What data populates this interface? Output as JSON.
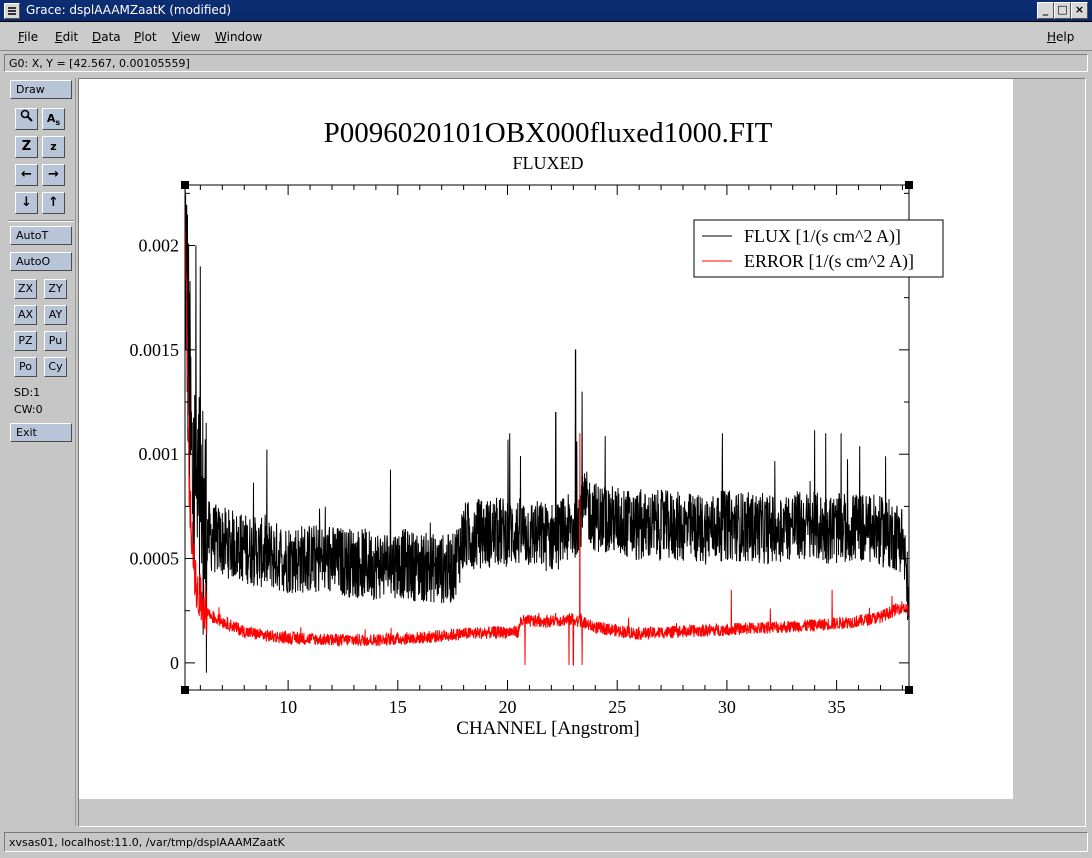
{
  "window": {
    "title": "Grace: dsplAAAMZaatK (modified)",
    "buttons": [
      "_",
      "□",
      "×"
    ]
  },
  "menubar": {
    "items": [
      {
        "label": "File",
        "accel": "F",
        "rest": "ile"
      },
      {
        "label": "Edit",
        "accel": "E",
        "rest": "dit"
      },
      {
        "label": "Data",
        "accel": "D",
        "rest": "ata"
      },
      {
        "label": "Plot",
        "accel": "P",
        "rest": "lot"
      },
      {
        "label": "View",
        "accel": "V",
        "rest": "iew"
      },
      {
        "label": "Window",
        "accel": "W",
        "rest": "indow"
      }
    ],
    "help": {
      "label": "Help",
      "accel": "H",
      "rest": "elp"
    }
  },
  "coord_readout": "G0: X, Y = [42.567, 0.00105559]",
  "toolbar": {
    "draw": "Draw",
    "icon_buttons": [
      {
        "glyph": "🔍",
        "name": "zoom-icon"
      },
      {
        "glyph": "Aᵇ",
        "name": "text-icon"
      },
      {
        "glyph": "Z",
        "name": "zoom-in-icon"
      },
      {
        "glyph": "z",
        "name": "zoom-out-icon"
      },
      {
        "glyph": "←",
        "name": "arrow-left-icon"
      },
      {
        "glyph": "→",
        "name": "arrow-right-icon"
      },
      {
        "glyph": "↓",
        "name": "arrow-down-icon"
      },
      {
        "glyph": "↑",
        "name": "arrow-up-icon"
      }
    ],
    "autot": "AutoT",
    "autoo": "AutoO",
    "small_buttons": [
      "ZX",
      "ZY",
      "AX",
      "AY",
      "PZ",
      "Pu",
      "Po",
      "Cy"
    ],
    "sd": "SD:1",
    "cw": "CW:0",
    "exit": "Exit"
  },
  "status": "xvsas01, localhost:11.0, /var/tmp/dsplAAAMZaatK",
  "colors": {
    "flux": "#000000",
    "error": "#ff0000",
    "button": "#b8c4d8",
    "titlebar": "#0d2e73"
  },
  "chart_data": {
    "type": "line",
    "title": "P0096020101OBX000fluxed1000.FIT",
    "subtitle": "FLUXED",
    "xlabel": "CHANNEL [Angstrom]",
    "ylabel": "",
    "xlim": [
      5.3,
      38.3
    ],
    "ylim": [
      -0.00013,
      0.00229
    ],
    "xticks": [
      10,
      15,
      20,
      25,
      30,
      35
    ],
    "yticks": [
      0,
      0.0005,
      0.001,
      0.0015,
      0.002
    ],
    "ytick_labels": [
      "0",
      "0.0005",
      "0.001",
      "0.0015",
      "0.002"
    ],
    "legend_position": "top-right",
    "series": [
      {
        "name": "FLUX [1/(s cm^2 A)]",
        "color": "#000000",
        "x": [
          5.3,
          5.6,
          6.0,
          6.5,
          7,
          8,
          9,
          10,
          11,
          12,
          13,
          14,
          15,
          16,
          17,
          17.5,
          18,
          18.5,
          19,
          20,
          21,
          22,
          23,
          23.3,
          23.6,
          24,
          25,
          26,
          27,
          28,
          29,
          30,
          31,
          32,
          33,
          34,
          35,
          36,
          37,
          38,
          38.3
        ],
        "y": [
          0.0021,
          0.0009,
          0.00065,
          0.0006,
          0.00058,
          0.00055,
          0.00052,
          0.0005,
          0.0005,
          0.00049,
          0.00048,
          0.00047,
          0.00048,
          0.00046,
          0.00045,
          0.00045,
          0.0006,
          0.00062,
          0.00062,
          0.00063,
          0.00062,
          0.0006,
          0.00065,
          0.00072,
          0.00075,
          0.0007,
          0.00068,
          0.00065,
          0.00066,
          0.00065,
          0.00064,
          0.00066,
          0.00065,
          0.00064,
          0.00066,
          0.00065,
          0.00064,
          0.00065,
          0.00063,
          0.0006,
          0.0003
        ],
        "noise": 0.00017,
        "spikes": [
          [
            5.8,
            0.002
          ],
          [
            6.0,
            0.0019
          ],
          [
            20.1,
            0.0011
          ],
          [
            22.2,
            0.0012
          ],
          [
            23.1,
            0.0015
          ],
          [
            23.4,
            0.0013
          ],
          [
            29.8,
            0.0011
          ],
          [
            34.5,
            0.0011
          ],
          [
            35.2,
            0.0011
          ]
        ]
      },
      {
        "name": "ERROR [1/(s cm^2 A)]",
        "color": "#ff0000",
        "x": [
          5.3,
          5.5,
          5.8,
          6.0,
          6.5,
          7,
          8,
          9,
          10,
          12,
          14,
          16,
          18,
          20.5,
          20.6,
          22,
          23,
          24,
          26,
          28,
          30,
          32,
          34,
          36,
          37,
          38,
          38.3
        ],
        "y": [
          0.0022,
          0.0008,
          0.00035,
          0.0003,
          0.00022,
          0.0002,
          0.00015,
          0.00013,
          0.00012,
          0.00011,
          0.00011,
          0.00012,
          0.00014,
          0.00015,
          0.0002,
          0.0002,
          0.00021,
          0.00017,
          0.00014,
          0.00015,
          0.00016,
          0.00017,
          0.00018,
          0.0002,
          0.00022,
          0.00027,
          0.00025
        ],
        "noise": 3e-05,
        "spikes": [
          [
            20.8,
            -1e-05
          ],
          [
            22.8,
            -1e-05
          ],
          [
            23.0,
            -1e-05
          ],
          [
            23.3,
            0.0011
          ],
          [
            23.4,
            -1e-05
          ],
          [
            30.2,
            0.00035
          ],
          [
            34.8,
            0.00035
          ]
        ]
      }
    ]
  }
}
